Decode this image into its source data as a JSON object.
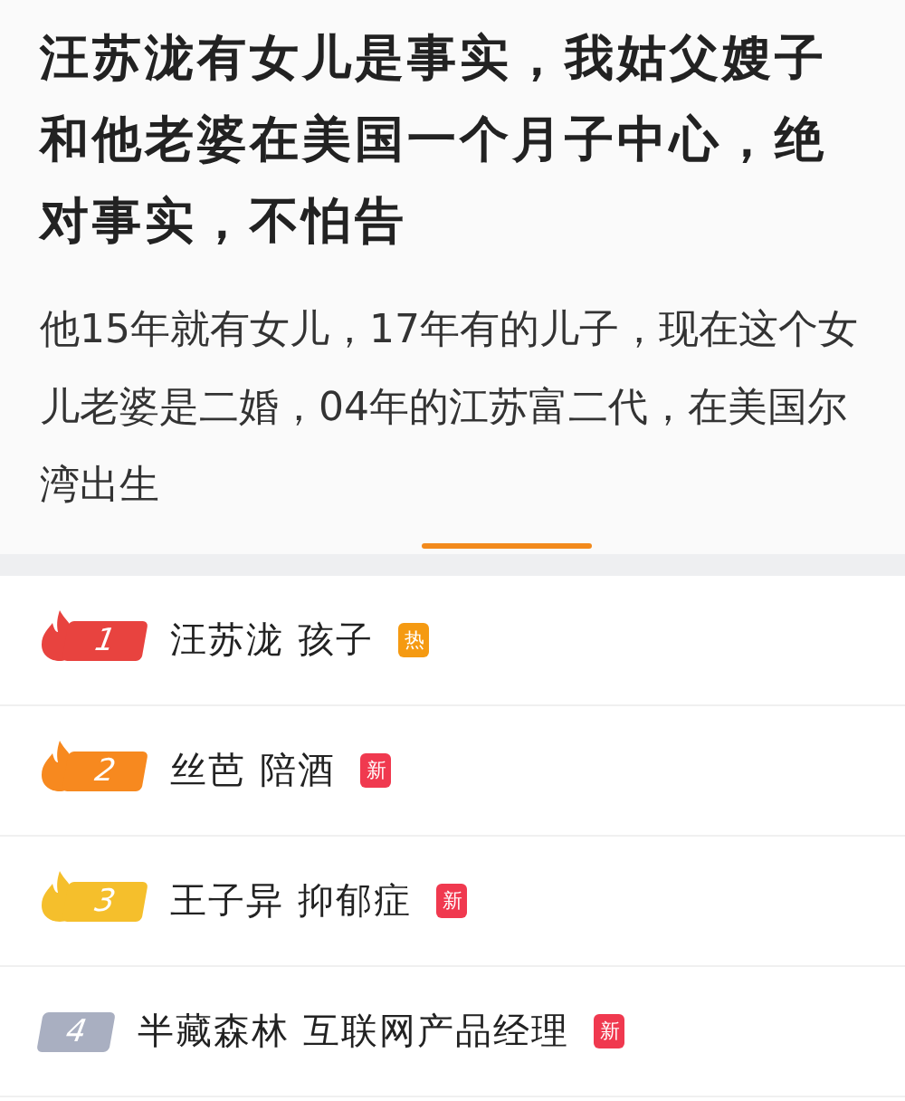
{
  "post": {
    "title": "汪苏泷有女儿是事实，我姑父嫂子和他老婆在美国一个月子中心，绝对事实，不怕告",
    "body": "他15年就有女儿，17年有的儿子，现在这个女儿老婆是二婚，04年的江苏富二代，在美国尔湾出生"
  },
  "hot_list": [
    {
      "rank": "1",
      "kind": "flame",
      "color": "#e8433f",
      "topic": "汪苏泷 孩子",
      "tag": {
        "label": "热",
        "color": "#f59a12"
      }
    },
    {
      "rank": "2",
      "kind": "flame",
      "color": "#f7891f",
      "topic": "丝芭 陪酒",
      "tag": {
        "label": "新",
        "color": "#f0394f"
      }
    },
    {
      "rank": "3",
      "kind": "flame",
      "color": "#f5bf2c",
      "topic": "王子异 抑郁症",
      "tag": {
        "label": "新",
        "color": "#f0394f"
      }
    },
    {
      "rank": "4",
      "kind": "plain",
      "color": "#a9afc1",
      "topic": "半藏森林 互联网产品经理",
      "tag": {
        "label": "新",
        "color": "#f0394f"
      }
    }
  ]
}
